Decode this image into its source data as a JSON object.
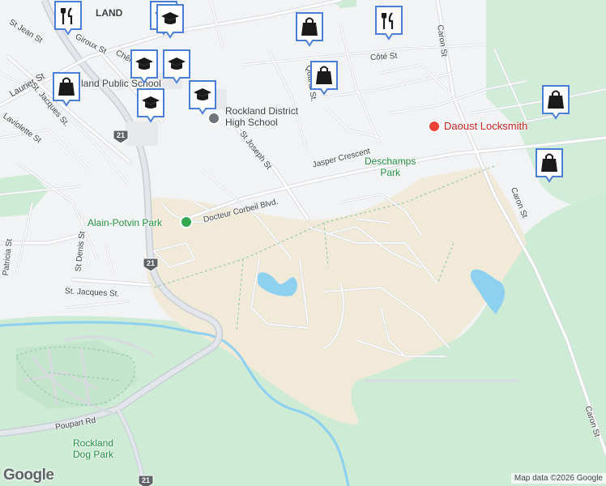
{
  "map": {
    "colors": {
      "background": "#f1f3f4",
      "park": "#cdebd5",
      "park_dark": "#bde2c8",
      "sand": "#f2ead9",
      "water": "#8ed0f0",
      "road": "#ffffff",
      "road_outline": "#d9dce0",
      "highway": "#dfe3e8",
      "marker_blue": "#4a7fd9"
    },
    "streets": {
      "st_jean": "St Jean St",
      "giroux": "Giroux St",
      "chene": "Chêne St.",
      "laurier": "Laurier St",
      "st_jacques_nw": "St. Jacques St.",
      "laviolette": "Laviolette St",
      "quartz": "Quartz St.",
      "cote": "Côté St",
      "caron_top": "Caron St",
      "caron_mid": "Caron St",
      "caron_bottom": "Caron St",
      "st_joseph": "St Joseph St",
      "jasper": "Jasper Crescent",
      "docteur_corbeil": "Docteur Corbeil Blvd.",
      "st_denis": "St Denis St",
      "st_jacques_sw": "St. Jacques St.",
      "poupart": "Poupart Rd",
      "patricia": "Patricia St"
    },
    "places": {
      "city_fragment": "LAND",
      "public_school": "land Public School",
      "high_school": "Rockland District\nHigh School",
      "locksmith": "Daoust Locksmith",
      "deschamps_park": "Deschamps\nPark",
      "alain_potvin_park": "Alain-Potvin Park",
      "dog_park": "Rockland\nDog Park"
    },
    "routes": {
      "r21_a": "21",
      "r21_b": "21",
      "r21_c": "21"
    },
    "markers": [
      {
        "icon": "restaurant-icon",
        "name": "restaurant-marker-1"
      },
      {
        "icon": "school-icon",
        "name": "school-marker-1"
      },
      {
        "icon": "shopping-bag-icon",
        "name": "shopping-marker-1"
      },
      {
        "icon": "restaurant-icon",
        "name": "restaurant-marker-2"
      },
      {
        "icon": "school-icon",
        "name": "school-marker-2"
      },
      {
        "icon": "school-icon",
        "name": "school-marker-3"
      },
      {
        "icon": "shopping-bag-icon",
        "name": "shopping-marker-2"
      },
      {
        "icon": "shopping-bag-icon",
        "name": "shopping-marker-3"
      },
      {
        "icon": "school-icon",
        "name": "school-marker-4"
      },
      {
        "icon": "school-icon",
        "name": "school-marker-5"
      },
      {
        "icon": "school-icon",
        "name": "school-marker-6"
      },
      {
        "icon": "shopping-bag-icon",
        "name": "shopping-marker-4"
      },
      {
        "icon": "shopping-bag-icon",
        "name": "shopping-marker-5"
      }
    ],
    "footer": {
      "logo": "Google",
      "attribution": "Map data ©2026 Google"
    }
  }
}
